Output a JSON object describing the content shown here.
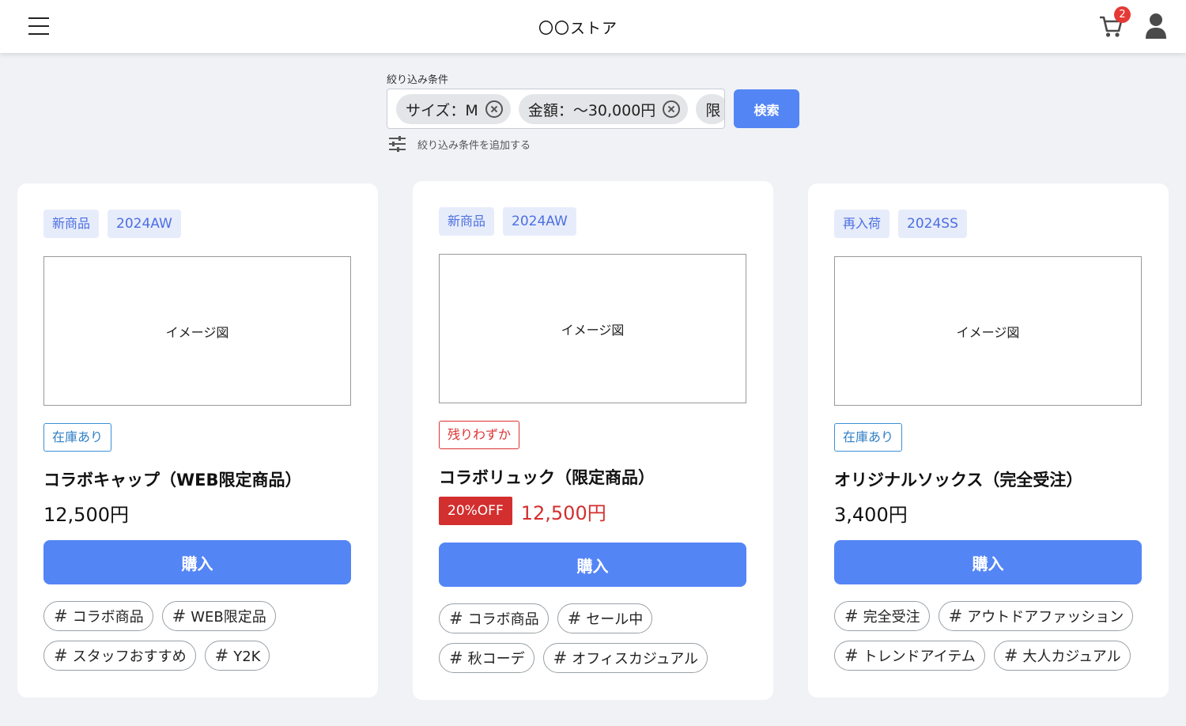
{
  "header": {
    "title": "〇〇ストア",
    "cart_count": "2",
    "menu_icon": "hamburger-icon",
    "cart_icon": "cart-icon",
    "user_icon": "user-icon"
  },
  "filter": {
    "label": "絞り込み条件",
    "chips": [
      "サイズ：M",
      "金額：～30,000円",
      "限"
    ],
    "search_label": "検索",
    "add_label": "絞り込み条件を追加する"
  },
  "colors": {
    "accent": "#5485f5",
    "sale": "#d32f2f",
    "in_stock": "#2f7fc6",
    "background": "#f0f2f6"
  },
  "products": [
    {
      "tags": [
        "新商品",
        "2024AW"
      ],
      "image_label": "イメージ図",
      "stock": "在庫あり",
      "name": "コラボキャップ（WEB限定商品）",
      "price": "12,500円",
      "buy": "購入",
      "hashtags": [
        [
          "コラボ商品",
          "WEB限定品"
        ],
        [
          "スタッフおすすめ",
          "Y2K"
        ]
      ]
    },
    {
      "tags": [
        "新商品",
        "2024AW"
      ],
      "image_label": "イメージ図",
      "stock": "残りわずか",
      "name": "コラボリュック（限定商品）",
      "discount": "20%OFF",
      "price": "12,500円",
      "buy": "購入",
      "hashtags": [
        [
          "コラボ商品",
          "セール中"
        ],
        [
          "秋コーデ",
          "オフィスカジュアル"
        ]
      ]
    },
    {
      "tags": [
        "再入荷",
        "2024SS"
      ],
      "image_label": "イメージ図",
      "stock": "在庫あり",
      "name": "オリジナルソックス（完全受注）",
      "price": "3,400円",
      "buy": "購入",
      "hashtags": [
        [
          "完全受注",
          "アウトドアファッション"
        ],
        [
          "トレンドアイテム",
          "大人カジュアル"
        ]
      ]
    }
  ],
  "hash_symbol": "#"
}
